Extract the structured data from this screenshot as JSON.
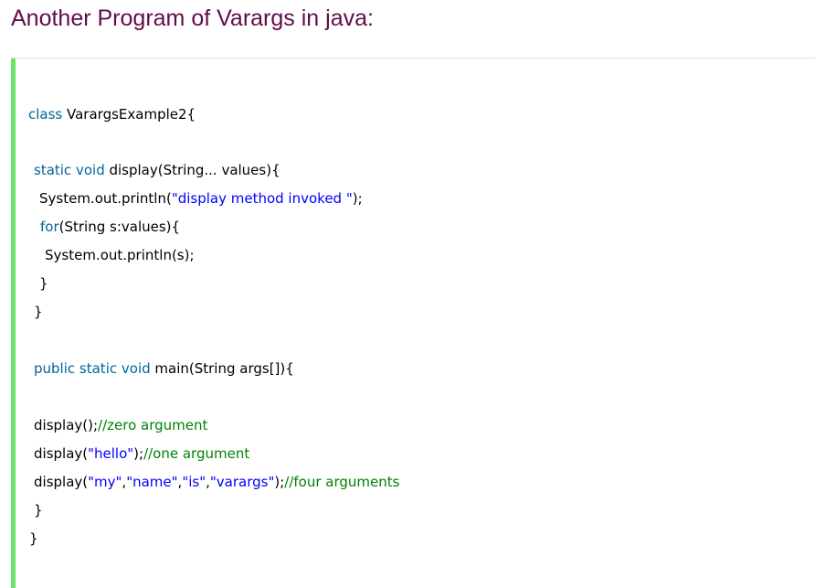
{
  "heading": "Another Program of Varargs in java:",
  "colors": {
    "heading": "#610B4B",
    "keyword": "#006699",
    "string": "#0000ff",
    "comment": "#008200",
    "gutter_bar": "#6CE26C"
  },
  "code": {
    "language": "java",
    "lines": [
      [
        {
          "t": "kw",
          "v": "class"
        },
        {
          "t": "plain",
          "v": " VarargsExample2{"
        }
      ],
      [
        {
          "t": "kw",
          "v": "static"
        },
        {
          "t": "plain",
          "v": " "
        },
        {
          "t": "kw",
          "v": "void"
        },
        {
          "t": "plain",
          "v": " display(String... values){"
        }
      ],
      [
        {
          "t": "plain",
          "v": "System.out.println("
        },
        {
          "t": "str",
          "v": "\"display method invoked \""
        },
        {
          "t": "plain",
          "v": ");"
        }
      ],
      [
        {
          "t": "kw",
          "v": "for"
        },
        {
          "t": "plain",
          "v": "(String s:values){"
        }
      ],
      [
        {
          "t": "plain",
          "v": "System.out.println(s);"
        }
      ],
      [
        {
          "t": "plain",
          "v": "}"
        }
      ],
      [
        {
          "t": "plain",
          "v": "}"
        }
      ],
      [
        {
          "t": "kw",
          "v": "public"
        },
        {
          "t": "plain",
          "v": " "
        },
        {
          "t": "kw",
          "v": "static"
        },
        {
          "t": "plain",
          "v": " "
        },
        {
          "t": "kw",
          "v": "void"
        },
        {
          "t": "plain",
          "v": " main(String args[]){"
        }
      ],
      [
        {
          "t": "plain",
          "v": "display();"
        },
        {
          "t": "cmt",
          "v": "//zero argument"
        }
      ],
      [
        {
          "t": "plain",
          "v": "display("
        },
        {
          "t": "str",
          "v": "\"hello\""
        },
        {
          "t": "plain",
          "v": ");"
        },
        {
          "t": "cmt",
          "v": "//one argument"
        }
      ],
      [
        {
          "t": "plain",
          "v": "display("
        },
        {
          "t": "str",
          "v": "\"my\""
        },
        {
          "t": "plain",
          "v": ","
        },
        {
          "t": "str",
          "v": "\"name\""
        },
        {
          "t": "plain",
          "v": ","
        },
        {
          "t": "str",
          "v": "\"is\""
        },
        {
          "t": "plain",
          "v": ","
        },
        {
          "t": "str",
          "v": "\"varargs\""
        },
        {
          "t": "plain",
          "v": ");"
        },
        {
          "t": "cmt",
          "v": "//four arguments"
        }
      ],
      [
        {
          "t": "plain",
          "v": "}"
        }
      ],
      [
        {
          "t": "plain",
          "v": "}"
        }
      ]
    ]
  }
}
